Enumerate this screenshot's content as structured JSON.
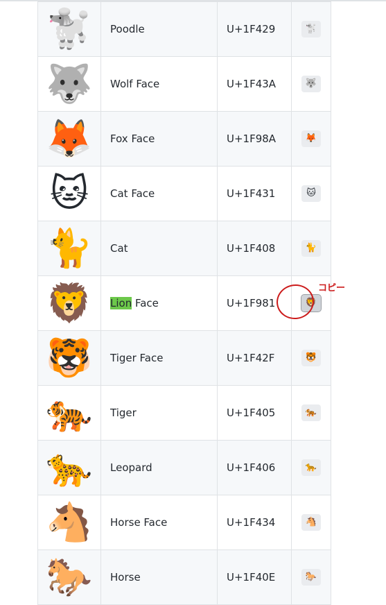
{
  "rows": [
    {
      "emoji": "🐩",
      "name": "Poodle",
      "code": "U+1F429"
    },
    {
      "emoji": "🐺",
      "name": "Wolf Face",
      "code": "U+1F43A"
    },
    {
      "emoji": "🦊",
      "name": "Fox Face",
      "code": "U+1F98A"
    },
    {
      "emoji": "🐱",
      "name": "Cat Face",
      "code": "U+1F431"
    },
    {
      "emoji": "🐈",
      "name": "Cat",
      "code": "U+1F408"
    },
    {
      "emoji": "🦁",
      "name_highlight": "Lion",
      "name_rest": " Face",
      "code": "U+1F981"
    },
    {
      "emoji": "🐯",
      "name": "Tiger Face",
      "code": "U+1F42F"
    },
    {
      "emoji": "🐅",
      "name": "Tiger",
      "code": "U+1F405"
    },
    {
      "emoji": "🐆",
      "name": "Leopard",
      "code": "U+1F406"
    },
    {
      "emoji": "🐴",
      "name": "Horse Face",
      "code": "U+1F434"
    },
    {
      "emoji": "🐎",
      "name": "Horse",
      "code": "U+1F40E"
    }
  ],
  "annotation": {
    "label": "コピー",
    "color": "#cc1b1b"
  },
  "colors": {
    "row_alt": "#f6f8fa",
    "border": "#dfe2e5",
    "highlight": "#6cc84a"
  }
}
